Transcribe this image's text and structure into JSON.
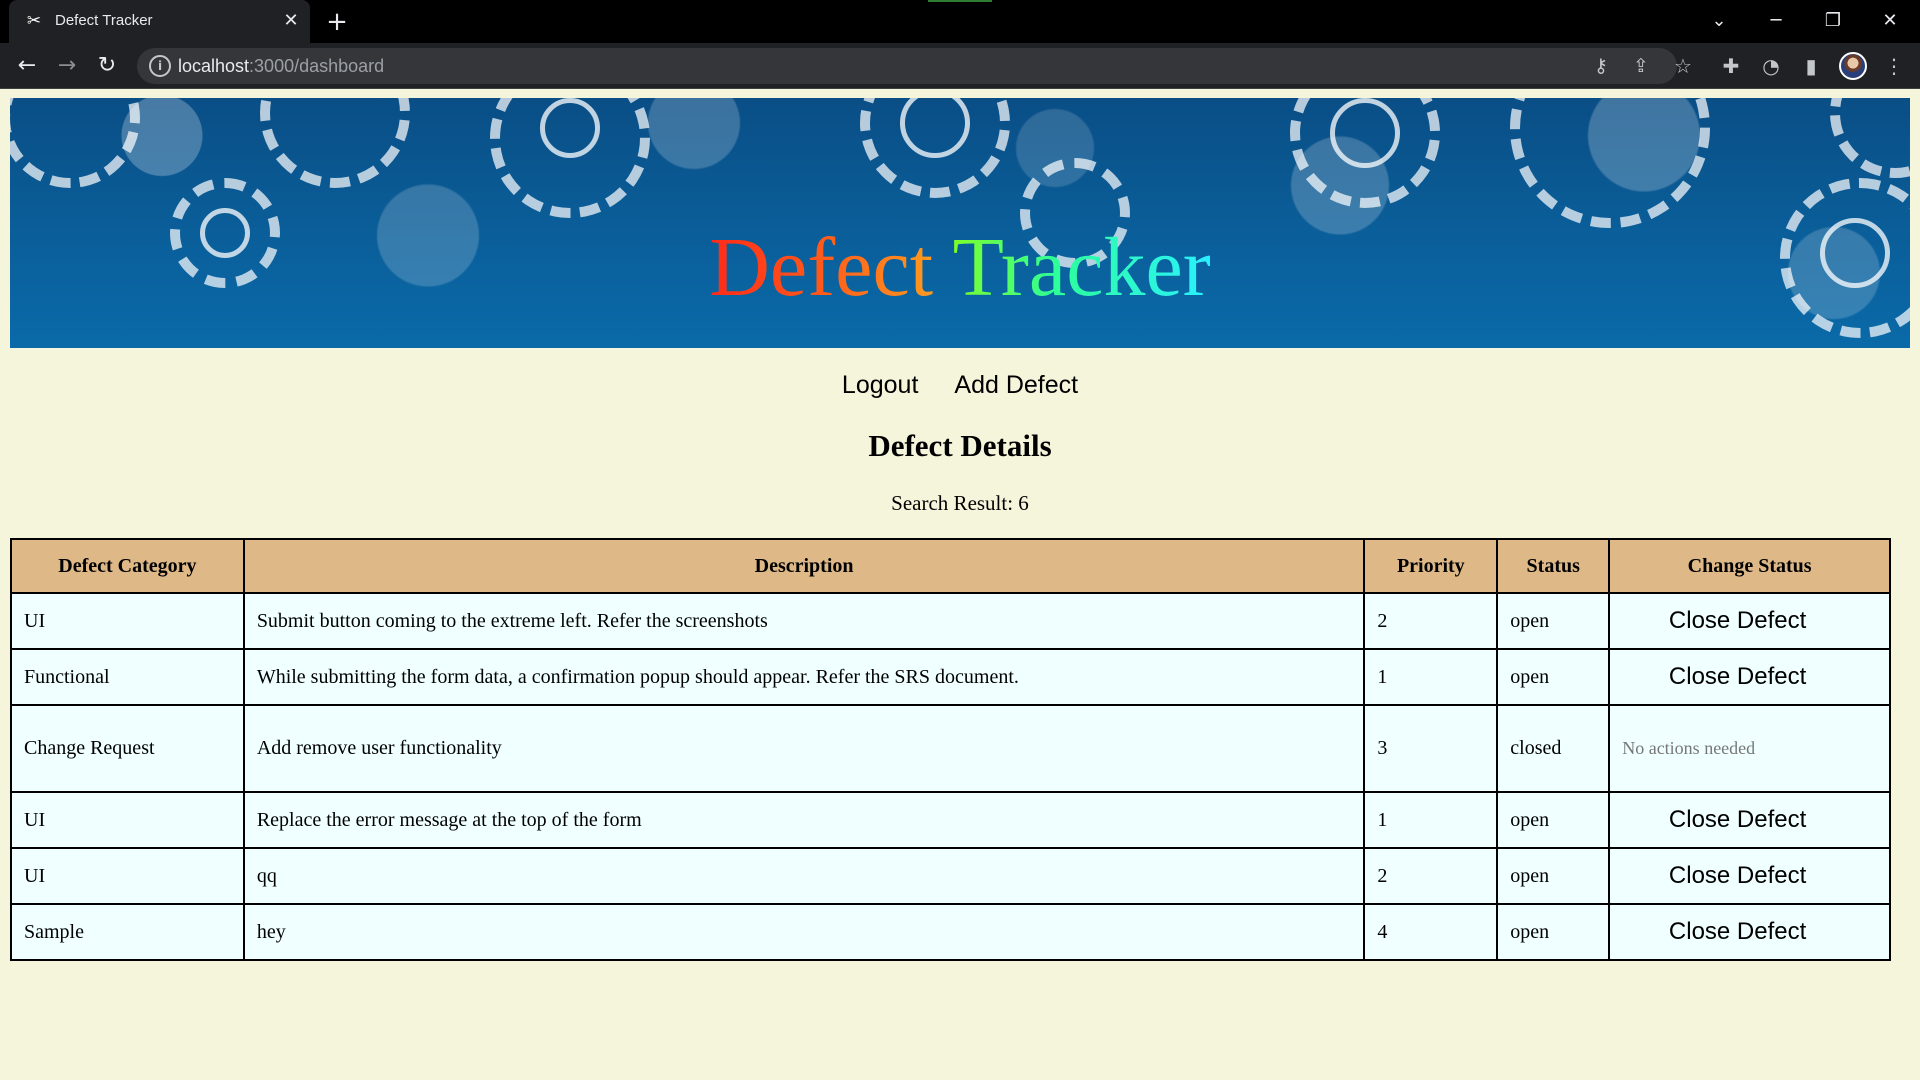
{
  "browser": {
    "tab_title": "Defect Tracker",
    "url_host": "localhost",
    "url_path": ":3000/dashboard"
  },
  "banner": {
    "title_part1": "Defect",
    "title_part2": "Tracker"
  },
  "nav": {
    "logout": "Logout",
    "add_defect": "Add Defect"
  },
  "main": {
    "heading": "Defect Details",
    "search_result": "Search Result: 6"
  },
  "table": {
    "headers": [
      "Defect Category",
      "Description",
      "Priority",
      "Status",
      "Change Status"
    ],
    "rows": [
      {
        "category": "UI",
        "description": "Submit button coming to the extreme left. Refer the screenshots",
        "priority": "2",
        "status": "open",
        "action": "Close Defect"
      },
      {
        "category": "Functional",
        "description": "While submitting the form data, a confirmation popup should appear. Refer the SRS document.",
        "priority": "1",
        "status": "open",
        "action": "Close Defect"
      },
      {
        "category": "Change Request",
        "description": "Add remove user functionality",
        "priority": "3",
        "status": "closed",
        "action": "No actions needed"
      },
      {
        "category": "UI",
        "description": "Replace the error message at the top of the form",
        "priority": "1",
        "status": "open",
        "action": "Close Defect"
      },
      {
        "category": "UI",
        "description": "qq",
        "priority": "2",
        "status": "open",
        "action": "Close Defect"
      },
      {
        "category": "Sample",
        "description": "hey",
        "priority": "4",
        "status": "open",
        "action": "Close Defect"
      }
    ]
  },
  "colors": {
    "page_bg": "#f5f5dc",
    "header_bg": "#deb887",
    "cell_bg": "#f0ffff"
  }
}
